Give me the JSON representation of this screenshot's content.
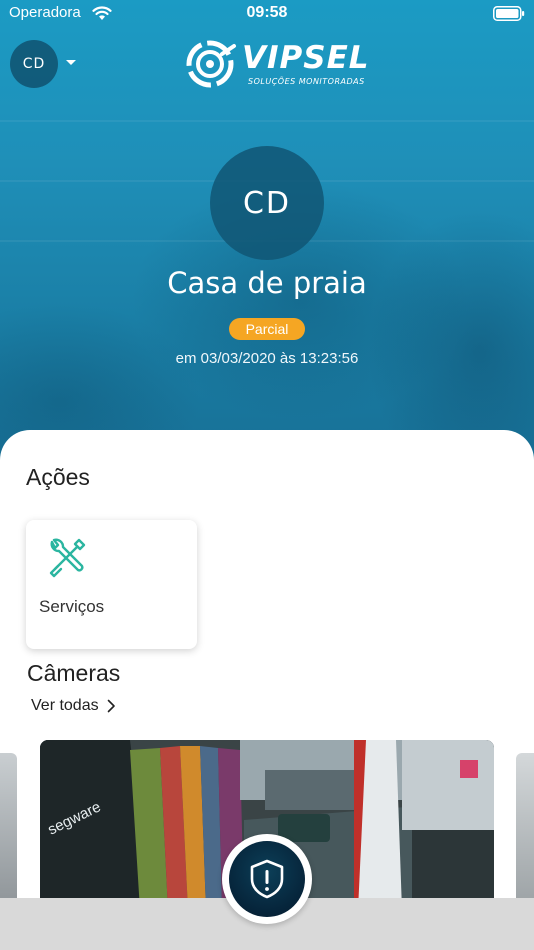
{
  "status_bar": {
    "carrier": "Operadora",
    "time": "09:58"
  },
  "header": {
    "account_initials": "CD",
    "logo_name": "VIPSEL",
    "logo_tagline": "SOLUÇÕES MONITORADAS"
  },
  "profile": {
    "initials": "CD",
    "name": "Casa de praia",
    "status": "Parcial",
    "timestamp": "em 03/03/2020 às 13:23:56"
  },
  "actions": {
    "title": "Ações",
    "items": [
      {
        "label": "Serviços",
        "icon": "tools-icon"
      }
    ]
  },
  "cameras": {
    "title": "Câmeras",
    "see_all": "Ver todas",
    "thumb_text": "segware"
  },
  "colors": {
    "hero": "#1f8fb8",
    "badge": "#f5a623",
    "accent_green": "#2bb5a0",
    "fab": "#06243a"
  }
}
